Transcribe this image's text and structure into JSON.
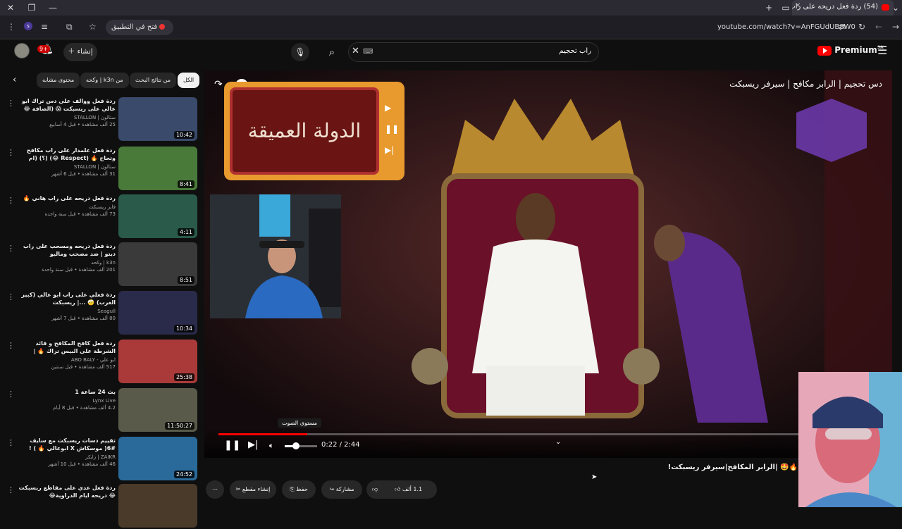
{
  "browser": {
    "tab_title": "(54) ردة فعل دريحه على راب",
    "open_in_app": "فتح في التطبيق",
    "url": "youtube.com/watch?v=AnFGUdUB8W0"
  },
  "header": {
    "search_value": "راب تحجيم",
    "create_label": "إنشاء",
    "notifications_count": "9+",
    "logo_text": "Premium",
    "logo_region": "SA"
  },
  "chips": [
    "الكل",
    "من نتائج البحث",
    "من k3n | وكحه",
    "محتوى مشابه"
  ],
  "recommendations": [
    {
      "title": "ردة فعل ووالف على دس تراك ابو عالي على ريسبكت 😱 (الصافة 😂🔥) (؟",
      "channel": "ستالون | STALLON",
      "meta": "25 ألف مشاهدة • قبل 4 أسابيع",
      "duration": "10:42"
    },
    {
      "title": "ردة فعل علمدار على راب مكافح وتحاح 🔥 (Respect 😂) (؟) (ام عرد 😂...",
      "channel": "ستالون | STALLON",
      "meta": "31 ألف مشاهدة • قبل 6 أشهر",
      "duration": "8:41"
    },
    {
      "title": "ردة فعل دريحه على راب هاني 🔥",
      "channel": "فايز ريسبكت",
      "meta": "73 ألف مشاهدة • قبل سنة واحدة",
      "duration": "4:11"
    },
    {
      "title": "ردة فعل دريحه ومسحب على راب ديتو | ضد مصحب وماليو",
      "channel": "k3n | وكحه",
      "meta": "201 ألف مشاهدة • قبل سنة واحدة",
      "duration": "8:51"
    },
    {
      "title": "ردة فعلي على راب ابو عالي (كبير الغرب) 🤕 ...| ريسبكت",
      "channel": "Seagull",
      "meta": "80 ألف مشاهدة • قبل 7 أشهر",
      "duration": "10:34"
    },
    {
      "title": "ردة فعل كافح المكافح و قائد الشرطة على البيس تراك 🔥 | سيرفر ريسبكت | 🔥",
      "channel": "ابو علي - ABO BALY",
      "meta": "517 ألف مشاهدة • قبل سنتين",
      "duration": "25:38"
    },
    {
      "title": "بث 24 ساعة 1",
      "channel": "Lynx Live",
      "meta": "4.2 ألف مشاهدة • قبل 8 أيام",
      "duration": "11:50:27"
    },
    {
      "title": "تقييم دسات ريسبكت مع سايف #6( موسكاش X ابوعالي 🔥 ) !",
      "channel": "ZAIKR | زايكر",
      "meta": "46 ألف مشاهدة • قبل 10 أشهر",
      "duration": "24:52"
    },
    {
      "title": "ردة فعل عدي على مقاطع ريسبكت 😂 دريحه ايام الدراوية😂",
      "channel": "",
      "meta": "",
      "duration": ""
    }
  ],
  "player": {
    "title": "دس تحجيم | الرابر مكافح | سيرفر ريسبكت",
    "overlay_text": "الدولة العميقة",
    "progress": 0.134,
    "volume": 0.35,
    "time": "0:22 / 2:44",
    "volume_tooltip": "مستوى الصوت"
  },
  "below": {
    "video_title": "🔥🤩 |الرابر المكافح|سيرفر ريسبكت! 🔥",
    "likes": "1.1 ألف",
    "share": "مشاركة",
    "save": "حفظ",
    "clip": "إنشاء مقطع"
  },
  "icons": [
    "close-icon",
    "restore-icon",
    "minimize-icon",
    "plus-icon",
    "mic-icon",
    "search-icon",
    "bell-icon",
    "menu-icon",
    "like-icon",
    "dislike-icon",
    "share-icon",
    "save-icon",
    "scissors-icon",
    "more-icon",
    "play-icon",
    "pause-icon",
    "next-icon",
    "volume-icon",
    "chevron-down-icon"
  ],
  "colors": {
    "youtube_red": "#ff0000",
    "background": "#0f0f0f",
    "chip": "#272727"
  }
}
